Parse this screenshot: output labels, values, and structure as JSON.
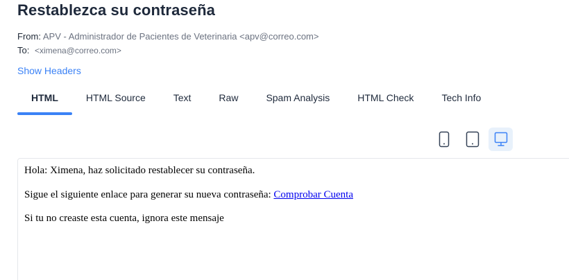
{
  "email": {
    "subject": "Restablezca su contraseña",
    "from_label": "From:",
    "from_value": "APV - Administrador de Pacientes de Veterinaria <apv@correo.com>",
    "to_label": "To:",
    "to_value": "<ximena@correo.com>",
    "show_headers": "Show Headers"
  },
  "tabs": [
    {
      "label": "HTML",
      "active": true
    },
    {
      "label": "HTML Source",
      "active": false
    },
    {
      "label": "Text",
      "active": false
    },
    {
      "label": "Raw",
      "active": false
    },
    {
      "label": "Spam Analysis",
      "active": false
    },
    {
      "label": "HTML Check",
      "active": false
    },
    {
      "label": "Tech Info",
      "active": false
    }
  ],
  "view_modes": [
    {
      "icon": "mobile-icon",
      "active": false
    },
    {
      "icon": "tablet-icon",
      "active": false
    },
    {
      "icon": "desktop-icon",
      "active": true
    }
  ],
  "body": {
    "line1": "Hola: Ximena, haz solicitado restablecer su contraseña.",
    "line2_text": "Sigue el siguiente enlace para generar su nueva contraseña: ",
    "line2_link": "Comprobar Cuenta",
    "line3": "Si tu no creaste esta cuenta, ignora este mensaje"
  },
  "colors": {
    "accent": "#3b82f6",
    "link": "#0000ee",
    "title": "#1e293b",
    "muted": "#6b7280",
    "active_view_bg": "#e8f1fb"
  }
}
